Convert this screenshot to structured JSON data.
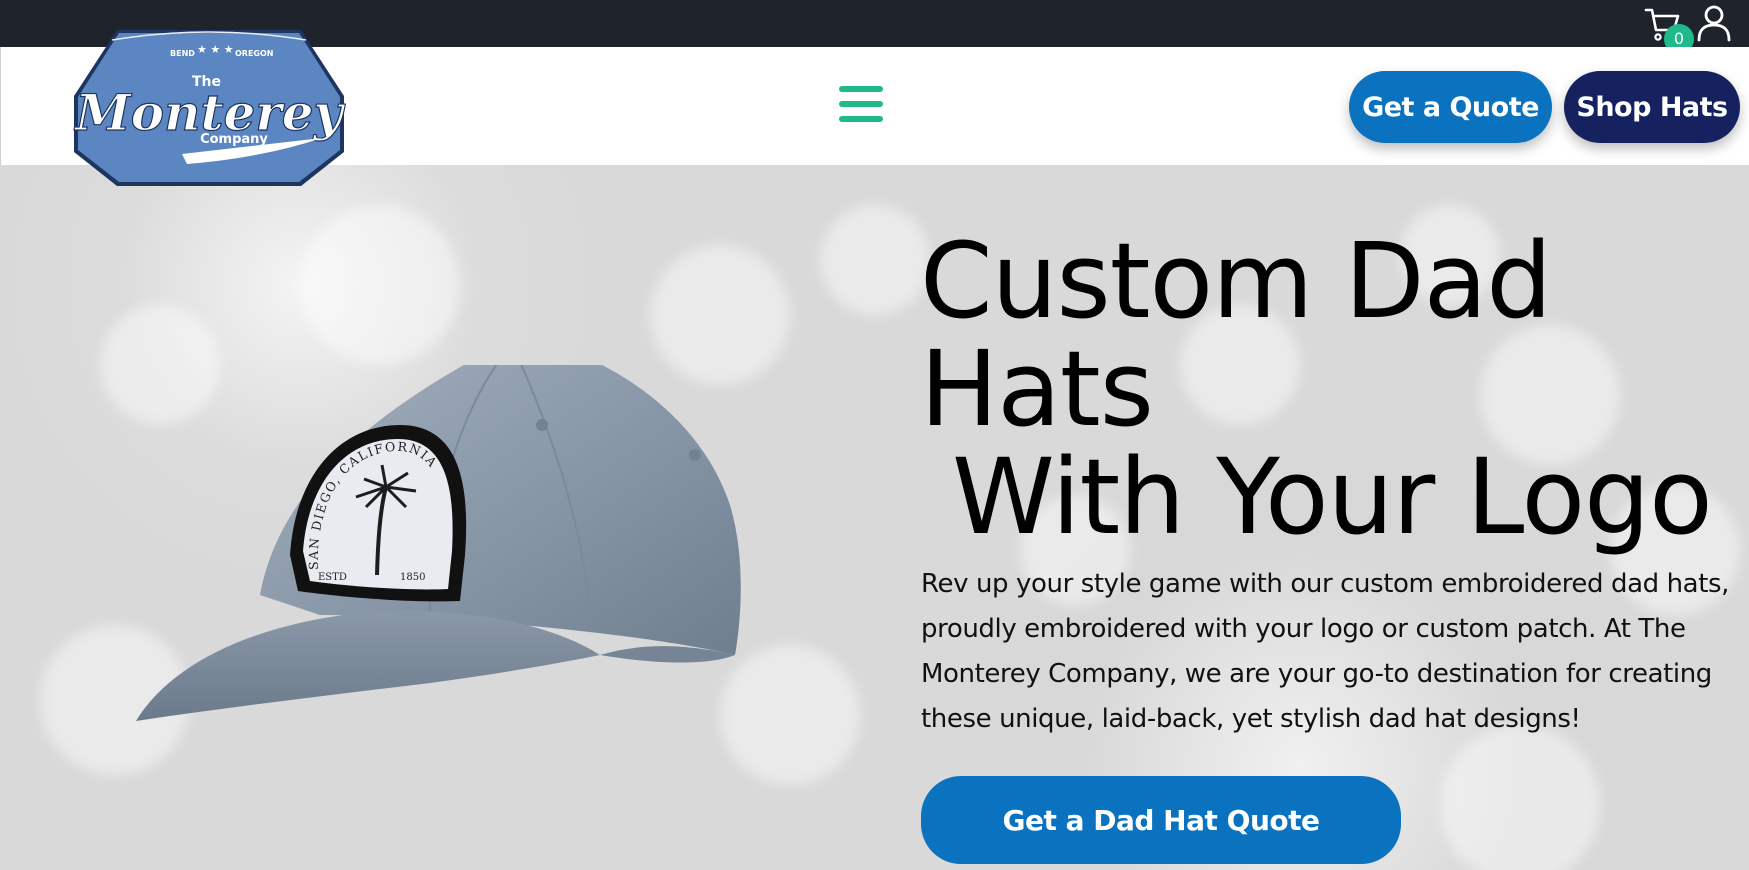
{
  "topbar": {
    "cart_count": "0",
    "cart_icon": "cart-icon",
    "user_icon": "user-icon",
    "badge_color": "#1fb98a"
  },
  "header": {
    "logo": {
      "top_text": "BEND",
      "top_text_right": "OREGON",
      "the": "The",
      "name": "Monterey",
      "company": "Company"
    },
    "menu_icon": "hamburger-menu-icon",
    "get_quote_label": "Get a Quote",
    "shop_hats_label": "Shop Hats",
    "accent": "#1fb98a",
    "quote_color": "#0a72bf",
    "shop_color": "#15225f"
  },
  "hero": {
    "title_line1": "Custom Dad",
    "title_line2": "Hats",
    "title_line3": " With Your Logo",
    "description": "Rev up your style game with our custom embroidered dad hats, proudly embroidered with your logo or custom patch. At The Monterey Company, we are your go-to destination for creating these unique, laid-back, yet stylish dad hat designs!",
    "cta_label": "Get a Dad Hat Quote",
    "patch": {
      "arc_text": "SAN DIEGO, CALIFORNIA",
      "estd": "ESTD",
      "year": "1850"
    }
  }
}
